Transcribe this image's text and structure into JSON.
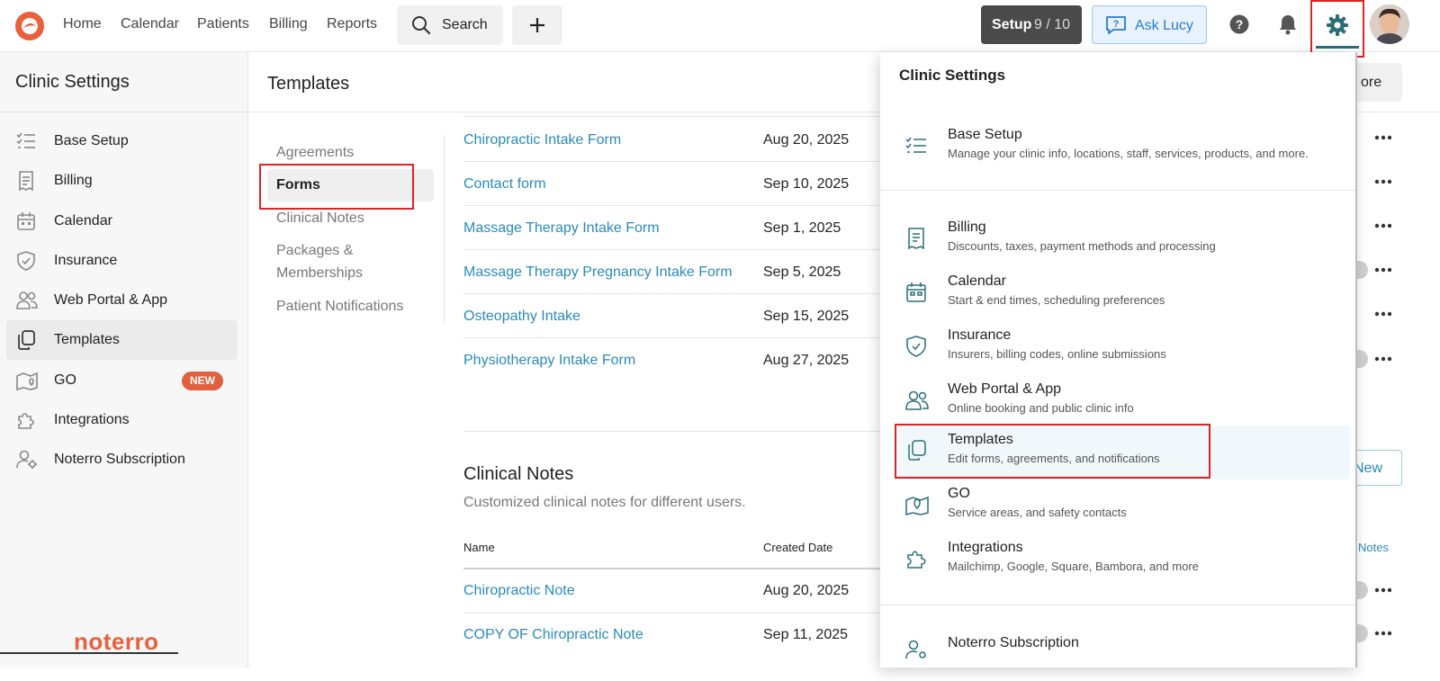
{
  "topbar": {
    "nav": [
      "Home",
      "Calendar",
      "Patients",
      "Billing",
      "Reports"
    ],
    "search_label": "Search",
    "setup_label": "Setup",
    "setup_progress": "9 / 10",
    "ask_label": "Ask Lucy"
  },
  "sidebar": {
    "title": "Clinic Settings",
    "items": [
      {
        "label": "Base Setup",
        "icon": "checklist-icon"
      },
      {
        "label": "Billing",
        "icon": "receipt-icon"
      },
      {
        "label": "Calendar",
        "icon": "calendar-icon"
      },
      {
        "label": "Insurance",
        "icon": "shield-icon"
      },
      {
        "label": "Web Portal & App",
        "icon": "users-icon"
      },
      {
        "label": "Templates",
        "icon": "copy-icon"
      },
      {
        "label": "GO",
        "icon": "map-pin-icon",
        "badge": "NEW"
      },
      {
        "label": "Integrations",
        "icon": "puzzle-icon"
      },
      {
        "label": "Noterro Subscription",
        "icon": "user-gear-icon"
      }
    ],
    "brand": "noterro"
  },
  "main": {
    "title": "Templates",
    "subnav": [
      "Agreements",
      "Forms",
      "Clinical Notes",
      "Packages &",
      "Memberships",
      "Patient Notifications"
    ],
    "more_label": "ore",
    "forms": [
      {
        "name": "Chiropractic Intake Form",
        "date": "Aug 20, 2025"
      },
      {
        "name": "Contact form",
        "date": "Sep 10, 2025"
      },
      {
        "name": "Massage Therapy Intake Form",
        "date": "Sep 1, 2025"
      },
      {
        "name": "Massage Therapy Pregnancy Intake Form",
        "date": "Sep 5, 2025"
      },
      {
        "name": "Osteopathy Intake",
        "date": "Sep 15, 2025"
      },
      {
        "name": "Physiotherapy Intake Form",
        "date": "Aug 27, 2025"
      }
    ],
    "clinical": {
      "title": "Clinical Notes",
      "desc": "Customized clinical notes for different users.",
      "col_name": "Name",
      "col_date": "Created Date",
      "new_label": "New",
      "notes_link": "Notes",
      "rows": [
        {
          "name": "Chiropractic Note",
          "date": "Aug 20, 2025"
        },
        {
          "name": "COPY OF Chiropractic Note",
          "date": "Sep 11, 2025"
        }
      ]
    }
  },
  "dropdown": {
    "title": "Clinic Settings",
    "items": [
      {
        "title": "Base Setup",
        "desc": "Manage your clinic info, locations, staff, services, products, and more."
      },
      {
        "title": "Billing",
        "desc": "Discounts, taxes, payment methods and processing"
      },
      {
        "title": "Calendar",
        "desc": "Start & end times, scheduling preferences"
      },
      {
        "title": "Insurance",
        "desc": "Insurers, billing codes, online submissions"
      },
      {
        "title": "Web Portal & App",
        "desc": "Online booking and public clinic info"
      },
      {
        "title": "Templates",
        "desc": "Edit forms, agreements, and notifications"
      },
      {
        "title": "GO",
        "desc": "Service areas, and safety contacts"
      },
      {
        "title": "Integrations",
        "desc": "Mailchimp, Google, Square, Bambora, and more"
      },
      {
        "title": "Noterro Subscription",
        "desc": ""
      }
    ]
  },
  "colors": {
    "accent": "#2a8ab8",
    "brand": "#e8603c",
    "highlight": "#e12222",
    "gear": "#2a6e78"
  }
}
